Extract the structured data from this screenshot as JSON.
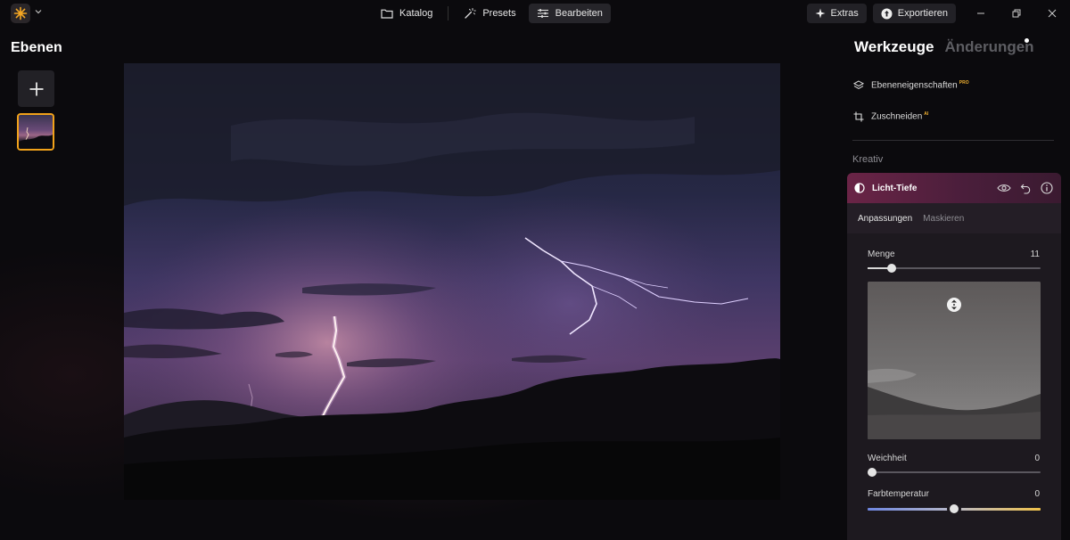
{
  "topbar": {
    "nav": [
      {
        "label": "Katalog",
        "icon": "folder-icon"
      },
      {
        "label": "Presets",
        "icon": "magic-wand-icon"
      },
      {
        "label": "Bearbeiten",
        "icon": "sliders-icon"
      }
    ],
    "active_nav": "Bearbeiten",
    "extras_label": "Extras",
    "export_label": "Exportieren"
  },
  "layers": {
    "title": "Ebenen"
  },
  "panel": {
    "tabs": [
      {
        "label": "Werkzeuge"
      },
      {
        "label": "Änderungen"
      }
    ],
    "active_tab": "Werkzeuge",
    "tools": [
      {
        "label": "Ebeneneigenschaften",
        "badge": "PRO",
        "icon": "layers-icon"
      },
      {
        "label": "Zuschneiden",
        "badge": "AI",
        "icon": "crop-icon"
      }
    ],
    "section": "Kreativ",
    "card": {
      "title": "Licht-Tiefe",
      "subtabs": [
        {
          "label": "Anpassungen"
        },
        {
          "label": "Maskieren"
        }
      ],
      "active_subtab": "Anpassungen",
      "sliders": {
        "menge": {
          "label": "Menge",
          "value": "11"
        },
        "weichheit": {
          "label": "Weichheit",
          "value": "0"
        },
        "farbtemperatur": {
          "label": "Farbtemperatur",
          "value": "0"
        }
      }
    }
  },
  "colors": {
    "accent": "#f1a21a",
    "card_header": "#6a2446",
    "background": "#0b0a0d"
  }
}
